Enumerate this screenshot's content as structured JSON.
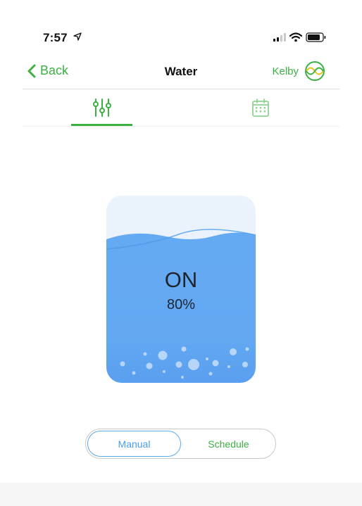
{
  "status_bar": {
    "time": "7:57",
    "icons": [
      "location-arrow-icon",
      "cellular-signal-icon",
      "wifi-icon",
      "battery-icon"
    ]
  },
  "nav": {
    "back_label": "Back",
    "title": "Water",
    "user_name": "Kelby",
    "icons": [
      "chevron-left-icon",
      "user-logo-icon"
    ]
  },
  "tabs": [
    {
      "name": "controls",
      "icon": "sliders-icon",
      "active": true
    },
    {
      "name": "schedule",
      "icon": "calendar-icon",
      "active": false
    }
  ],
  "tank": {
    "state": "ON",
    "level": "80%",
    "level_fraction": 0.8
  },
  "mode_toggle": {
    "manual_label": "Manual",
    "schedule_label": "Schedule",
    "selected": "Manual"
  },
  "colors": {
    "accent_green": "#3cb043",
    "water_blue": "#63a9f2",
    "selected_blue": "#4a9de6"
  }
}
